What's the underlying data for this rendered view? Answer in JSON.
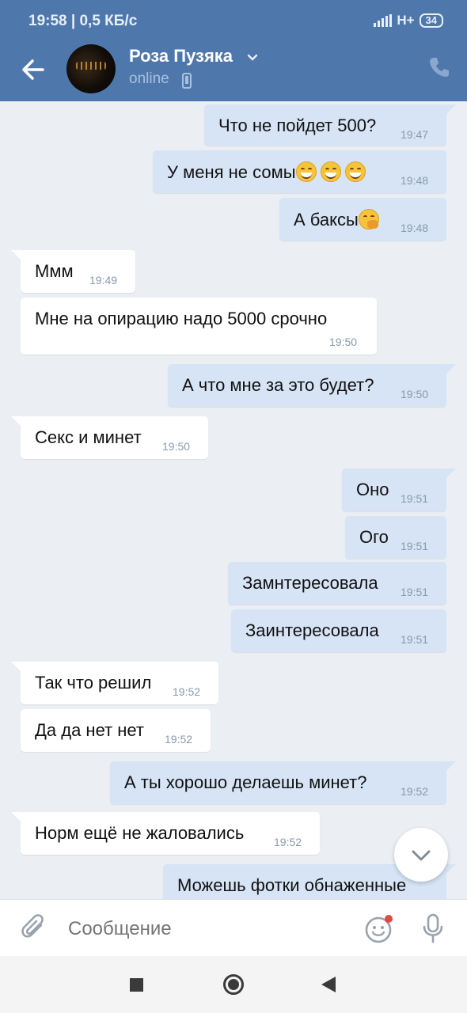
{
  "status_bar": {
    "time": "19:58 | 0,5 КБ/с",
    "network": "H+",
    "battery": "34"
  },
  "header": {
    "name": "Роза Пузяка",
    "status": "online"
  },
  "messages": [
    {
      "dir": "out",
      "text": "Что не пойдет 500?",
      "time": "19:47"
    },
    {
      "dir": "out",
      "text": "У меня не сомы",
      "emoji": "😁😁😁",
      "time": "19:48"
    },
    {
      "dir": "out",
      "text": "А баксы",
      "emoji": "🤭",
      "time": "19:48"
    },
    {
      "dir": "in",
      "text": "Ммм",
      "time": "19:49"
    },
    {
      "dir": "in",
      "text": "Мне на опирацию  надо 5000 срочно",
      "time": "19:50"
    },
    {
      "dir": "out",
      "text": "А что мне за это будет?",
      "time": "19:50"
    },
    {
      "dir": "in",
      "text": "Секс и минет",
      "time": "19:50"
    },
    {
      "dir": "out",
      "text": "Оно",
      "time": "19:51"
    },
    {
      "dir": "out",
      "text": "Ого",
      "time": "19:51"
    },
    {
      "dir": "out",
      "text": "Замнтересовала",
      "time": "19:51"
    },
    {
      "dir": "out",
      "text": "Заинтересовала",
      "time": "19:51"
    },
    {
      "dir": "in",
      "text": "Так что решил",
      "time": "19:52"
    },
    {
      "dir": "in",
      "text": "Да да нет нет",
      "time": "19:52"
    },
    {
      "dir": "out",
      "text": "А ты хорошо делаешь минет?",
      "time": "19:52"
    },
    {
      "dir": "in",
      "text": "Норм ещё не жаловались",
      "time": "19:52"
    },
    {
      "dir": "out",
      "text": "Можешь фотки обнаженные",
      "time": ""
    }
  ],
  "composer": {
    "placeholder": "Сообщение"
  },
  "icons": {
    "back": "arrow-left-icon",
    "call": "phone-icon",
    "attach": "paperclip-icon",
    "sticker": "smile-icon",
    "mic": "microphone-icon",
    "scroll": "chevron-down-icon"
  },
  "colors": {
    "header": "#4e78ac",
    "outgoing": "#d6e4f5",
    "incoming": "#ffffff",
    "background": "#ebeff4"
  }
}
